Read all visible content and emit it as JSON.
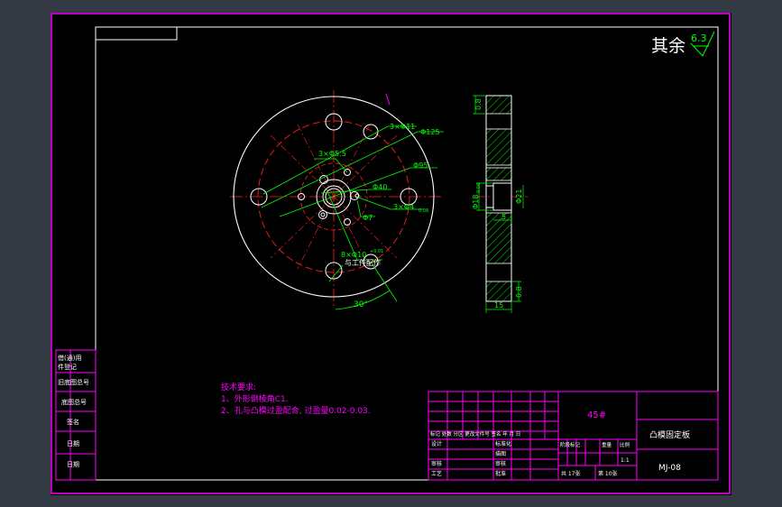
{
  "colors": {
    "workspace_bg": "#333a43",
    "paper": "#000000",
    "frame": "#ff00ff",
    "outline": "#ffffff",
    "centerline": "#ff2020",
    "dimension": "#00ff00",
    "hatch": "#00ff00",
    "title_text": "#ffffff",
    "notes_text": "#ff00ff"
  },
  "roughness": {
    "label": "其余",
    "value": "6.3"
  },
  "front_view": {
    "dims": {
      "d_holes_outer": "3×Φ11",
      "d_outer": "Φ125",
      "d_holes_inner": "3×Φ5.5",
      "d_pcd": "Φ95",
      "d_hub": "Φ40",
      "d_small_holes": "3×Φ4",
      "d_small_holes_tol": "0.08",
      "d_center": "Φ7",
      "d_pin": "8×Φ10",
      "d_pin_tol": "+0.01",
      "pin_note": "与工件配作",
      "angle": "30°"
    }
  },
  "side_view": {
    "dims": {
      "t_top": "0.8",
      "d_bore": "Φ18",
      "d_bore_tol": "0.06",
      "d_cbore": "Φ21",
      "depth": "5",
      "t_bottom": "0.8",
      "width": "15"
    }
  },
  "notes": {
    "heading": "技术要求:",
    "line1": "1、外形倒棱角C1.",
    "line2": "2、孔与凸模过盈配合, 过盈量0.02-0.03."
  },
  "left_strip": [
    "借(通)用",
    "件登记",
    "旧底图总号",
    "底图总号",
    "签名",
    "日期",
    "日期"
  ],
  "title_block": {
    "material": "45#",
    "part_name": "凸模固定板",
    "drawing_no": "MJ-08",
    "scale": "1:1",
    "sheet_total": "共 17张",
    "sheet_no": "第 10张",
    "headers": {
      "revision_row": "标记 处数 分区 更改文件号 签名 年 月 日",
      "design": "设计",
      "standardize": "标准化",
      "stage": "阶段标记",
      "weight": "重量",
      "scale_label": "比例",
      "drawing": "描图",
      "review": "审核",
      "process": "工艺",
      "approve": "批准",
      "check": "审核"
    }
  }
}
